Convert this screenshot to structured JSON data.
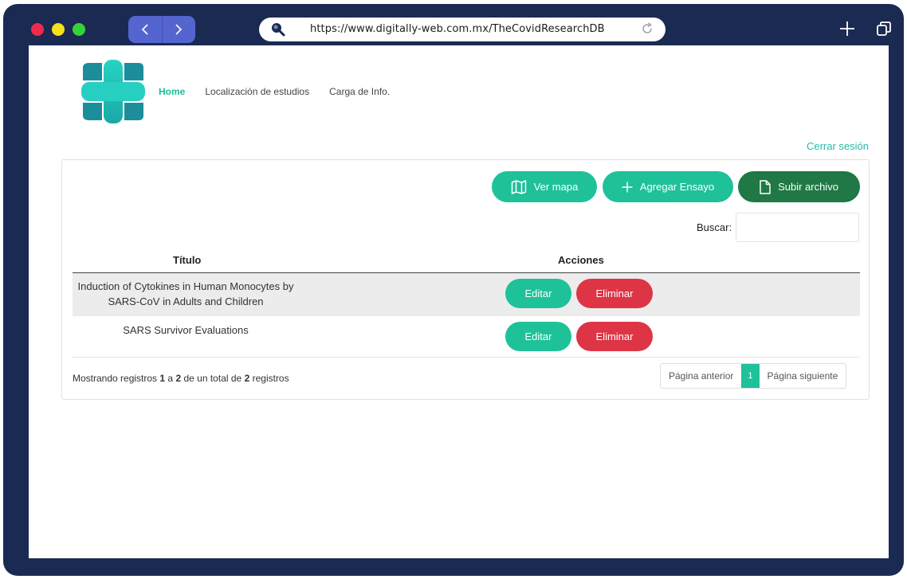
{
  "browser": {
    "url": "https://www.digitally-web.com.mx/TheCovidResearchDB",
    "traffic_colors": [
      "#ee2b4e",
      "#f8e01a",
      "#35d33b"
    ]
  },
  "nav": {
    "home": "Home",
    "locations": "Localización de estudios",
    "upload_info": "Carga de Info."
  },
  "logout": "Cerrar sesión",
  "toolbar": {
    "map": "Ver mapa",
    "add": "Agregar Ensayo",
    "upload": "Subir archivo"
  },
  "search": {
    "label": "Buscar:",
    "value": ""
  },
  "table": {
    "headers": {
      "title": "Título",
      "actions": "Acciones"
    },
    "rows": [
      {
        "title": "Induction of Cytokines in Human Monocytes by SARS-CoV in Adults and Children",
        "edit": "Editar",
        "delete": "Eliminar"
      },
      {
        "title": "SARS Survivor Evaluations",
        "edit": "Editar",
        "delete": "Eliminar"
      }
    ]
  },
  "footer": {
    "info_prefix": "Mostrando registros",
    "from": "1",
    "to_word": "a",
    "to": "2",
    "total_prefix": "de un total de",
    "total": "2",
    "suffix": "registros"
  },
  "pager": {
    "prev": "Página anterior",
    "current": "1",
    "next": "Página siguiente"
  },
  "colors": {
    "accent": "#1fc199",
    "danger": "#dd3545",
    "upload": "#1f7845",
    "frame": "#1b2a52"
  }
}
